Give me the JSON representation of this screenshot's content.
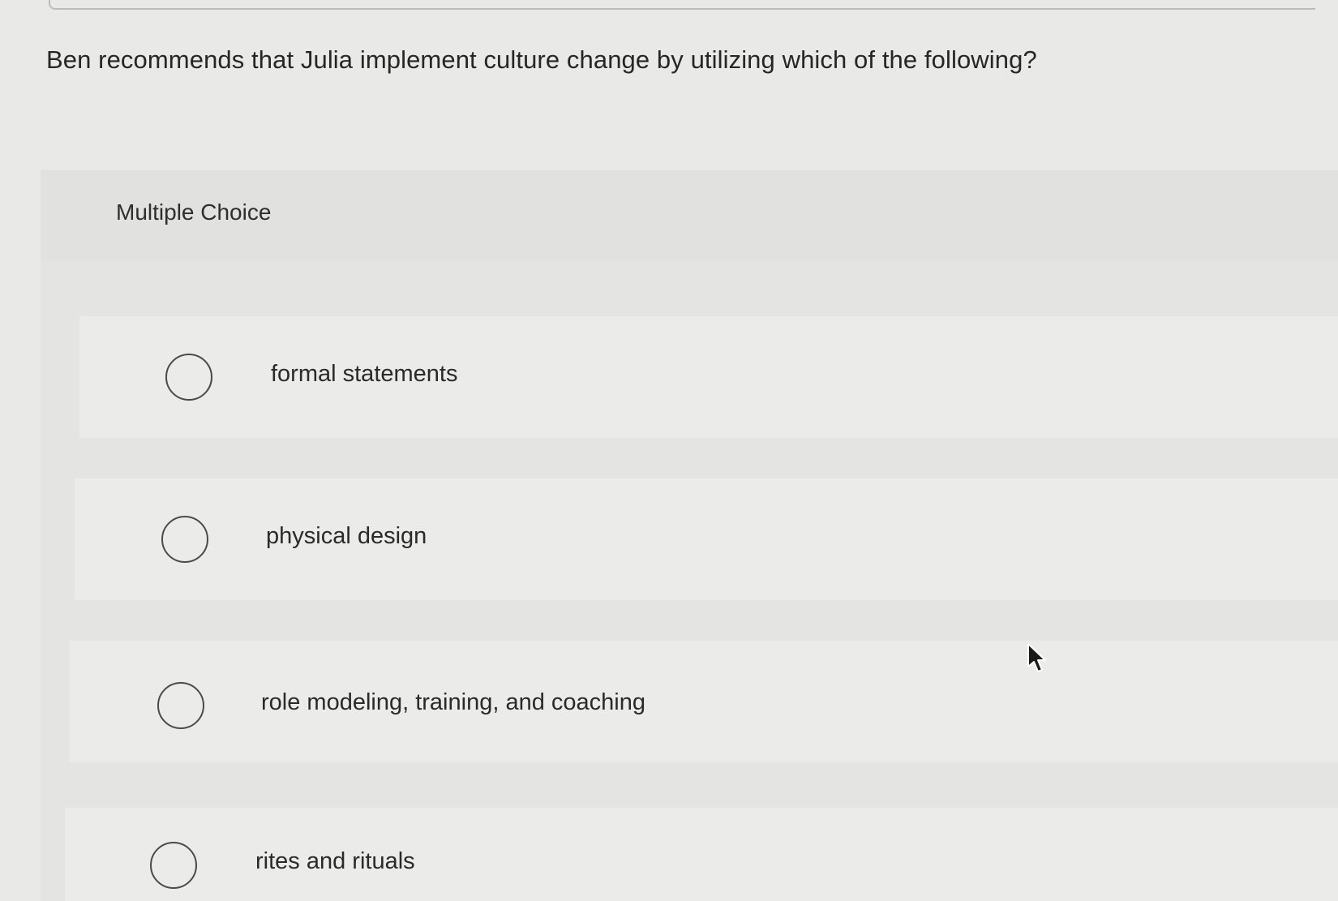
{
  "question": {
    "text": "Ben recommends that Julia implement culture change by utilizing which of the following?"
  },
  "answer_panel": {
    "type_label": "Multiple Choice",
    "choices": [
      {
        "label": "formal statements",
        "selected": false
      },
      {
        "label": "physical design",
        "selected": false
      },
      {
        "label": "role modeling, training, and coaching",
        "selected": false
      },
      {
        "label": "rites and rituals",
        "selected": false
      }
    ]
  },
  "icons": {
    "radio": "radio-circle-icon",
    "cursor": "mouse-pointer-icon"
  },
  "colors": {
    "background": "#e9e9e8",
    "panel": "#e4e4e3",
    "text": "#2a2a2a",
    "radio_border": "#4a4a4a"
  }
}
